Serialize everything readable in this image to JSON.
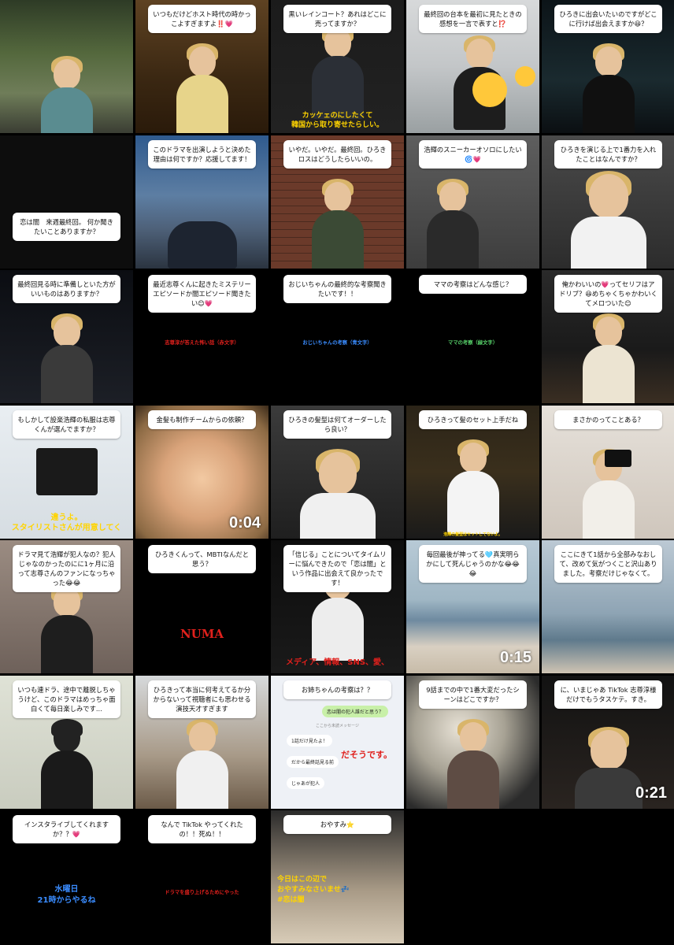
{
  "tiles": [
    {
      "question": "",
      "answer": "",
      "duration": ""
    },
    {
      "question": "いつもだけどホスト時代の時かっこよすぎますよ‼️💗",
      "answer": "",
      "duration": ""
    },
    {
      "question": "黒いレインコート？あれはどこに売ってますか？",
      "answer": "カッケェのにしたくて\n韓国から取り寄せたらしい。",
      "duration": ""
    },
    {
      "question": "最終回の台本を最初に見たときの感想を一言で表すと⁉️",
      "answer": "",
      "duration": ""
    },
    {
      "question": "ひろきに出会いたいのですがどこに行けば出会えますか😆？",
      "answer": "",
      "duration": ""
    },
    {
      "question": "恋は闇　来週最終回。\n何か聞きたいことありますか？",
      "answer": "",
      "duration": ""
    },
    {
      "question": "このドラマを出演しようと決めた理由は何ですか？応援してます！",
      "answer": "",
      "duration": ""
    },
    {
      "question": "いやだ。いやだ。最終回。ひろきロスはどうしたらいいの。",
      "answer": "",
      "duration": ""
    },
    {
      "question": "浩輝のスニーカーオソロにしたい🌀💗",
      "answer": "",
      "duration": ""
    },
    {
      "question": "ひろきを演じる上で1番力を入れたことはなんですか？",
      "answer": "",
      "duration": ""
    },
    {
      "question": "最終回見る時に準備しといた方がいいものはありますか？",
      "answer": "",
      "duration": ""
    },
    {
      "question": "最近志尊くんに起きたミステリーエピソードか闇エピソード聞きたい😊💗",
      "answer": "",
      "duration": ""
    },
    {
      "question": "おじいちゃんの最終的な考察聞きたいです！！",
      "answer": "",
      "duration": ""
    },
    {
      "question": "ママの考察はどんな感じ？",
      "answer": "",
      "duration": ""
    },
    {
      "question": "俺かわいいの💗ってセリフはアドリブ？😆めちゃくちゃかわいくてメロついた😊",
      "answer": "",
      "duration": ""
    },
    {
      "question": "もしかして設楽浩輝の私服は志尊くんが選んでますか？",
      "answer": "違うよ。\nスタイリストさんが用意してく",
      "duration": ""
    },
    {
      "question": "金髪も制作チームからの依頼？",
      "answer": "",
      "duration": "0:04"
    },
    {
      "question": "ひろきの髪型は何てオーダーしたら良い？",
      "answer": "",
      "duration": ""
    },
    {
      "question": "ひろきって髪のセット上手だね",
      "answer": "浩輝の髪型はセットしてないよ。",
      "duration": ""
    },
    {
      "question": "まさかのってことある？",
      "answer": "",
      "duration": ""
    },
    {
      "question": "ドラマ見て浩輝が犯人なの？犯人じゃなのかったのにに1ヶ月に沿って志尊さんのファンになっちゃった😂😂",
      "answer": "",
      "duration": ""
    },
    {
      "question": "ひろきくんって、MBTIなんだと思う？",
      "answer": "NUMA",
      "duration": ""
    },
    {
      "question": "「信じる」ことについてタイムリーに悩んできたので「恋は闇」という作品に出会えて良かったです！",
      "answer": "メディア、情報、SNS、愛、",
      "duration": ""
    },
    {
      "question": "毎回最後が神ってる🩵真実明らかにして死んじゃうのかな😂😂😂",
      "answer": "",
      "duration": "0:15"
    },
    {
      "question": "ここにきて1話から全部みなおして、改めて気がつくこと沢山ありました。考察だけじゃなくて。",
      "answer": "",
      "duration": ""
    },
    {
      "question": "いつも連ドラ、途中で離脱しちゃうけど、このドラマはめっちゃ面白くて毎日楽しみです...",
      "answer": "",
      "duration": ""
    },
    {
      "question": "ひろきって本当に何考えてるか分からないって視聴者にも思わせる演技天才すぎます",
      "answer": "",
      "duration": ""
    },
    {
      "question": "お姉ちゃんの考察は？？",
      "answer": "だそうです。",
      "duration": ""
    },
    {
      "question": "9話までの中で1番大変だったシーンはどこですか？",
      "answer": "",
      "duration": ""
    },
    {
      "question": "に、いまじゃあ TikTok 志尊淳様だけでもうタスケテ。すき。",
      "answer": "",
      "duration": "0:21"
    },
    {
      "question": "インスタライブしてくれますか？？💗",
      "answer": "水曜日\n21時からやるね",
      "duration": ""
    },
    {
      "question": "なんで TikTok やってくれたの！！死ぬ！！",
      "answer": "",
      "duration": ""
    },
    {
      "question": "おやすみ⭐",
      "answer": "今日はこの辺で\nおやすみなさいませ💤\n#恋は闇",
      "duration": ""
    }
  ],
  "chat": {
    "top_bubble": "恋は闇の犯人誰だと思う？",
    "sub_line": "ここから未読メッセージ",
    "bubbles": [
      "1話だけ見たよ！",
      "だから最終話見る前",
      "じゃあが犯人"
    ]
  },
  "colors": {
    "answer_red": "#e0201c",
    "answer_blue": "#3a8cff",
    "answer_green": "#57d26a",
    "answer_yellow": "#ffd400"
  }
}
